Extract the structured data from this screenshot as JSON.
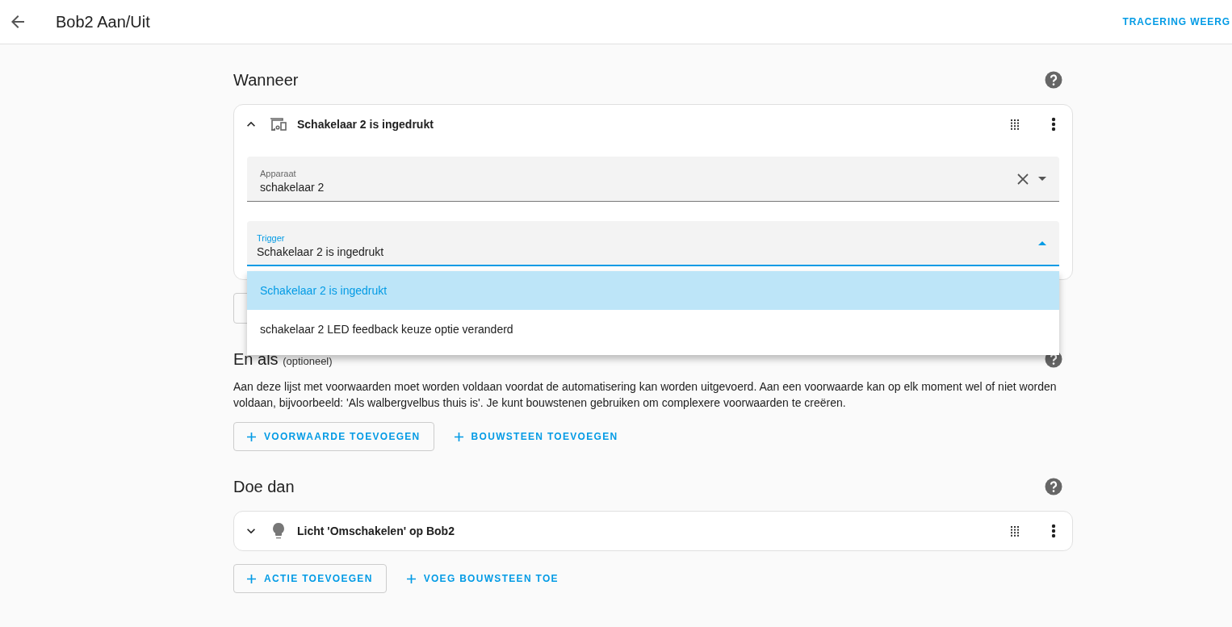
{
  "header": {
    "title": "Bob2 Aan/Uit",
    "action": "TRACERING WEERG"
  },
  "sections": [
    {
      "title": "Wanneer",
      "cards": [
        {
          "title": "Schakelaar 2 is ingedrukt",
          "kind": "device",
          "expanded": true,
          "fields": [
            {
              "label": "Apparaat",
              "value": "schakelaar 2",
              "clearable": true,
              "focused": false
            },
            {
              "label": "Trigger",
              "value": "Schakelaar 2 is ingedrukt",
              "clearable": false,
              "focused": true,
              "options": [
                {
                  "label": "Schakelaar 2 is ingedrukt",
                  "selected": true
                },
                {
                  "label": "schakelaar 2 LED feedback keuze optie veranderd",
                  "selected": false
                }
              ]
            }
          ]
        }
      ],
      "buttons": [
        {
          "kind": "covered"
        }
      ]
    },
    {
      "title": "En als",
      "suffix": "(optioneel)",
      "description": "Aan deze lijst met voorwaarden moet worden voldaan voordat de automatisering kan worden uitgevoerd. Aan een voorwaarde kan op elk moment wel of niet worden voldaan, bijvoorbeeld: 'Als walbergvelbus thuis is'. Je kunt bouwstenen gebruiken om complexere voorwaarden te creëren.",
      "buttons": [
        {
          "kind": "outlined",
          "label": "VOORWAARDE TOEVOEGEN"
        },
        {
          "kind": "text",
          "label": "BOUWSTEEN TOEVOEGEN"
        }
      ]
    },
    {
      "title": "Doe dan",
      "cards": [
        {
          "title": "Licht 'Omschakelen' op Bob2",
          "kind": "light",
          "expanded": false
        }
      ],
      "buttons": [
        {
          "kind": "outlined",
          "label": "ACTIE TOEVOEGEN"
        },
        {
          "kind": "text",
          "label": "VOEG BOUWSTEEN TOE"
        }
      ]
    }
  ]
}
